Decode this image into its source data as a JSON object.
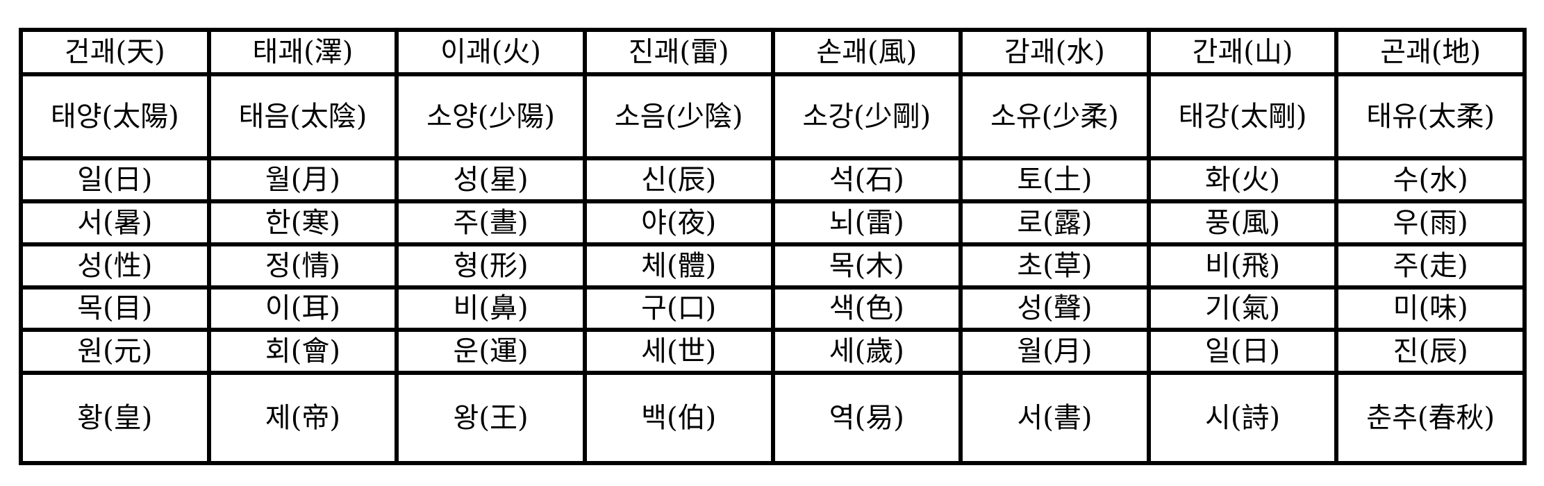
{
  "table": {
    "rows": [
      [
        "건괘(天)",
        "태괘(澤)",
        "이괘(火)",
        "진괘(雷)",
        "손괘(風)",
        "감괘(水)",
        "간괘(山)",
        "곤괘(地)"
      ],
      [
        "태양(太陽)",
        "태음(太陰)",
        "소양(少陽)",
        "소음(少陰)",
        "소강(少剛)",
        "소유(少柔)",
        "태강(太剛)",
        "태유(太柔)"
      ],
      [
        "일(日)",
        "월(月)",
        "성(星)",
        "신(辰)",
        "석(石)",
        "토(土)",
        "화(火)",
        "수(水)"
      ],
      [
        "서(暑)",
        "한(寒)",
        "주(晝)",
        "야(夜)",
        "뇌(雷)",
        "로(露)",
        "풍(風)",
        "우(雨)"
      ],
      [
        "성(性)",
        "정(情)",
        "형(形)",
        "체(體)",
        "목(木)",
        "초(草)",
        "비(飛)",
        "주(走)"
      ],
      [
        "목(目)",
        "이(耳)",
        "비(鼻)",
        "구(口)",
        "색(色)",
        "성(聲)",
        "기(氣)",
        "미(味)"
      ],
      [
        "원(元)",
        "회(會)",
        "운(運)",
        "세(世)",
        "세(歲)",
        "월(月)",
        "일(日)",
        "진(辰)"
      ],
      [
        "황(皇)",
        "제(帝)",
        "왕(王)",
        "백(伯)",
        "역(易)",
        "서(書)",
        "시(詩)",
        "춘추(春秋)"
      ]
    ]
  }
}
